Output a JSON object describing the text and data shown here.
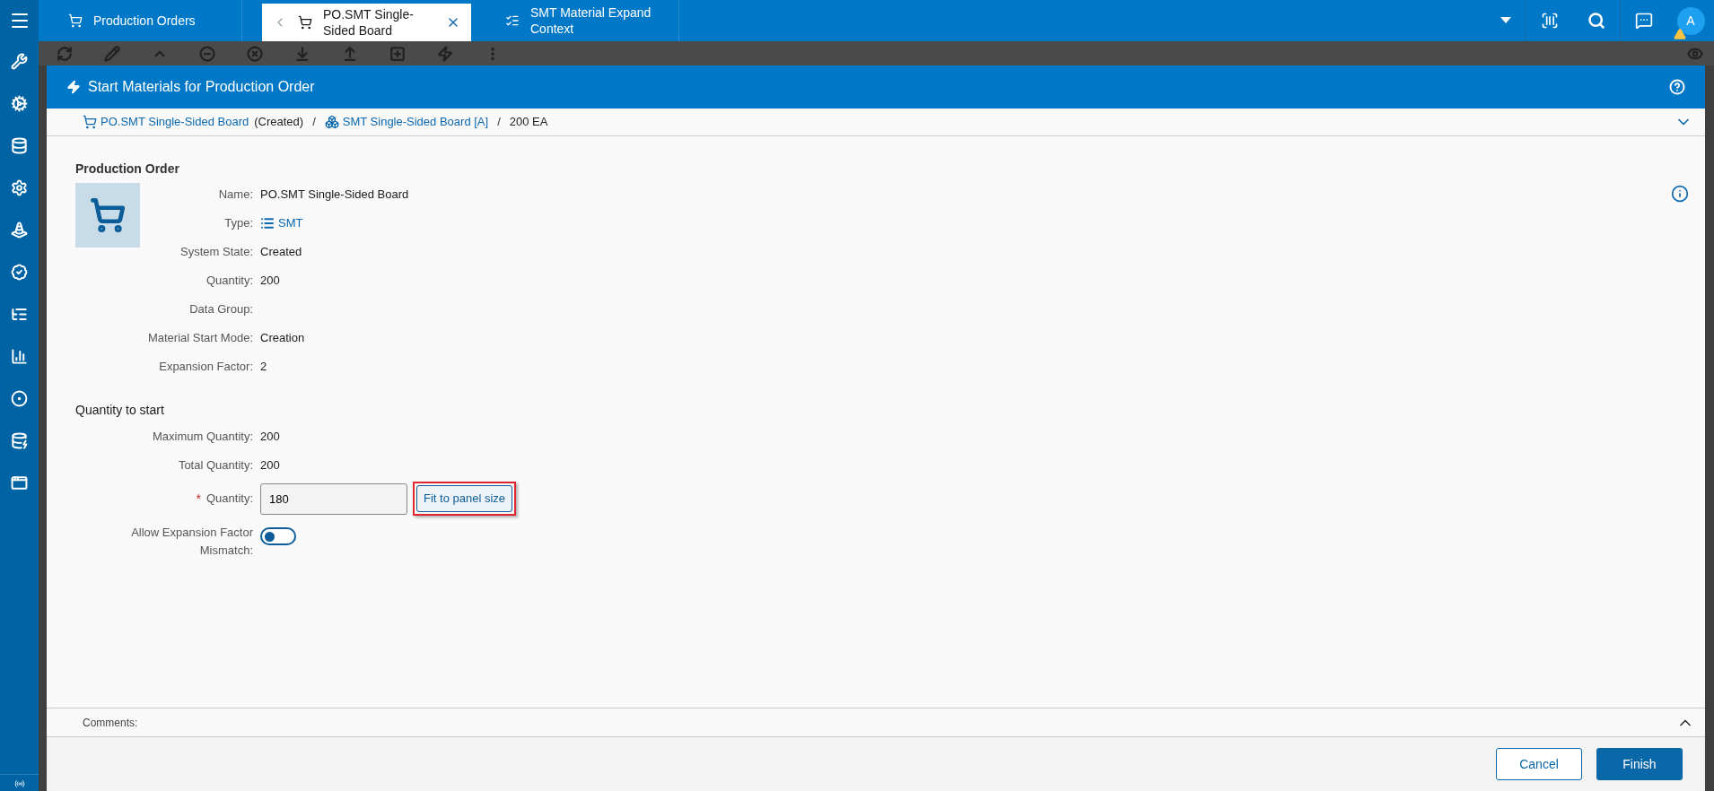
{
  "tabs": [
    {
      "label": "Production Orders",
      "kind": "order",
      "selected": false
    },
    {
      "label": "PO.SMT Single-Sided Board",
      "kind": "order",
      "selected": true
    },
    {
      "label": "SMT Material Expand Context",
      "kind": "context",
      "selected": false
    }
  ],
  "user": {
    "initial": "A",
    "warning": true
  },
  "dialog": {
    "title": "Start Materials for Production Order",
    "breadcrumb": [
      {
        "text": "PO.SMT Single-Sided Board",
        "kind": "order-link"
      },
      {
        "text": "(Created)",
        "kind": "plain"
      },
      {
        "text": "/",
        "kind": "separator"
      },
      {
        "text": "SMT Single-Sided Board [A]",
        "kind": "product-link"
      },
      {
        "text": "/",
        "kind": "separator"
      },
      {
        "text": "200 EA",
        "kind": "plain"
      }
    ],
    "breadcrumb_expanded": false,
    "order_section": {
      "heading": "Production Order",
      "fields": [
        {
          "label": "Name:",
          "value": "PO.SMT Single-Sided Board",
          "kind": "text"
        },
        {
          "label": "Type:",
          "value": "SMT",
          "kind": "link"
        },
        {
          "label": "System State:",
          "value": "Created",
          "kind": "text"
        },
        {
          "label": "Quantity:",
          "value": "200",
          "kind": "text"
        },
        {
          "label": "Data Group:"
        },
        {
          "label": "Material Start Mode:",
          "value": "Creation",
          "kind": "text"
        },
        {
          "label": "Expansion Factor:",
          "value": "2",
          "kind": "text"
        }
      ]
    },
    "quantity_section": {
      "heading": "Quantity to start",
      "fields": [
        {
          "label": "Maximum Quantity:",
          "value": "200"
        },
        {
          "label": "Total Quantity:",
          "value": "200"
        }
      ],
      "quantity": {
        "label": "Quantity:",
        "required_mark": "*",
        "value": "180",
        "button": "Fit to panel size",
        "highlighted": true
      },
      "toggle": {
        "label": "Allow Expansion Factor Mismatch:",
        "on": false
      }
    },
    "comments": {
      "label": "Comments:",
      "expanded": false
    },
    "buttons": [
      {
        "label": "Cancel",
        "kind": "secondary"
      },
      {
        "label": "Finish",
        "kind": "primary"
      }
    ]
  }
}
